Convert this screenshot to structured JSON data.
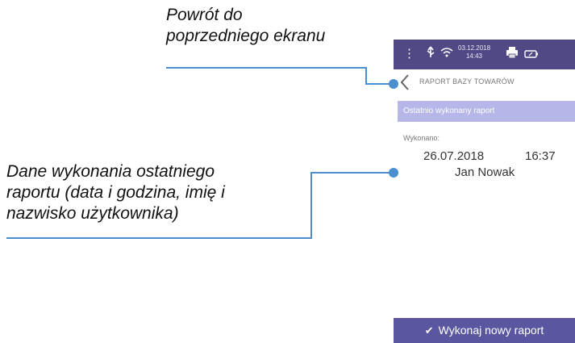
{
  "callouts": {
    "back": [
      "Powrót do",
      "poprzedniego ekranu"
    ],
    "data": [
      "Dane wykonania ostatniego",
      "raportu (data i godzina, imię i",
      "nazwisko użytkownika)"
    ]
  },
  "status_bar": {
    "date": "03.12.2018",
    "time": "14:43",
    "icons": [
      "menu-dots-icon",
      "usb-icon",
      "wifi-icon",
      "printer-icon",
      "battery-icon"
    ]
  },
  "appbar": {
    "title": "RAPORT BAZY TOWARÓW",
    "back_icon": "chevron-left-icon"
  },
  "section": {
    "title": "Ostatnio wykonany raport"
  },
  "report": {
    "label": "Wykonano:",
    "date": "26.07.2018",
    "time": "16:37",
    "user": "Jan Nowak"
  },
  "action": {
    "label": "Wykonaj nowy raport",
    "icon": "check-icon"
  },
  "colors": {
    "primary": "#4f4a86",
    "accent": "#5b56a0",
    "section": "#b6b6e8",
    "callout_line": "#4b8fd0"
  }
}
